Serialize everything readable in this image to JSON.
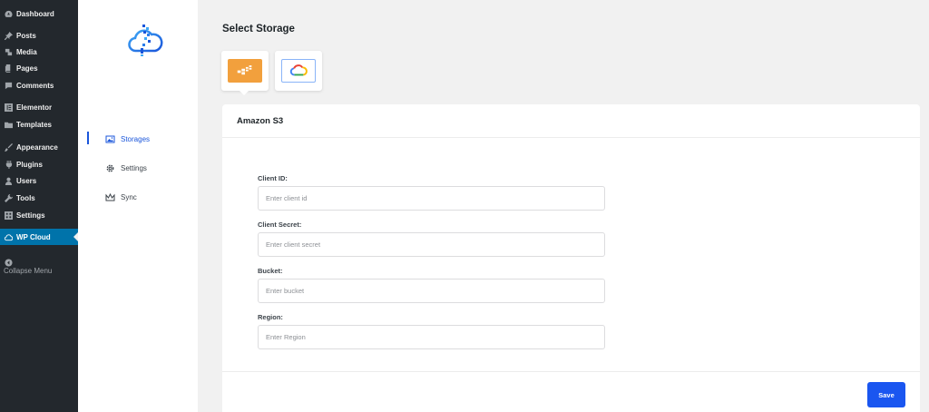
{
  "sidebar": {
    "items": [
      {
        "label": "Dashboard",
        "icon": "dashboard-icon"
      },
      {
        "label": "Posts",
        "icon": "pin-icon"
      },
      {
        "label": "Media",
        "icon": "media-icon"
      },
      {
        "label": "Pages",
        "icon": "pages-icon"
      },
      {
        "label": "Comments",
        "icon": "comment-icon"
      },
      {
        "label": "Elementor",
        "icon": "elementor-icon"
      },
      {
        "label": "Templates",
        "icon": "folder-icon"
      },
      {
        "label": "Appearance",
        "icon": "brush-icon"
      },
      {
        "label": "Plugins",
        "icon": "plug-icon"
      },
      {
        "label": "Users",
        "icon": "user-icon"
      },
      {
        "label": "Tools",
        "icon": "wrench-icon"
      },
      {
        "label": "Settings",
        "icon": "settings-icon"
      },
      {
        "label": "WP Cloud",
        "icon": "cloud-icon",
        "active": true
      },
      {
        "label": "Collapse Menu",
        "icon": "collapse-icon"
      }
    ]
  },
  "plugin_nav": {
    "items": [
      {
        "label": "Storages",
        "icon": "image-icon",
        "active": true
      },
      {
        "label": "Settings",
        "icon": "gear-icon"
      },
      {
        "label": "Sync",
        "icon": "crown-icon"
      }
    ]
  },
  "main": {
    "title": "Select Storage",
    "providers": [
      {
        "name": "amazon-s3",
        "icon": "s3-icon",
        "selected": true
      },
      {
        "name": "google-cloud",
        "icon": "google-cloud-icon"
      }
    ]
  },
  "card": {
    "title": "Amazon S3",
    "fields": [
      {
        "label": "Client ID:",
        "placeholder": "Enter client id"
      },
      {
        "label": "Client Secret:",
        "placeholder": "Enter client secret"
      },
      {
        "label": "Bucket:",
        "placeholder": "Enter bucket"
      },
      {
        "label": "Region:",
        "placeholder": "Enter Region"
      }
    ],
    "save_label": "Save"
  },
  "colors": {
    "accent": "#1a56f0",
    "wp_active": "#0073aa",
    "wp_sidebar": "#23282d",
    "s3_orange": "#f2a03d"
  }
}
